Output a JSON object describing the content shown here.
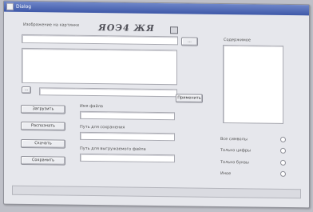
{
  "window": {
    "title": "Dialog"
  },
  "form": {
    "top_field_label": "Изображение на картинке",
    "captcha_text": "ЯОЭ4 ЖЯ",
    "browse_label": "...",
    "small_browse_label": "...",
    "apply_label": "Применить",
    "middle_label_1": "Имя файла",
    "middle_label_2": "Путь для сохранения",
    "middle_label_3": "Путь для выгружаемого файла"
  },
  "buttons": [
    {
      "label": "Загрузить"
    },
    {
      "label": "Распознать"
    },
    {
      "label": "Скачать"
    },
    {
      "label": "Сохранить"
    }
  ],
  "right_panel": {
    "list_label": "Содержимое"
  },
  "radio_options": [
    {
      "label": "Все символы"
    },
    {
      "label": "Только цифры"
    },
    {
      "label": "Только буквы"
    },
    {
      "label": "Иное"
    }
  ],
  "icons": {
    "title_icon": "window-icon",
    "captcha_refresh": "square-icon"
  }
}
